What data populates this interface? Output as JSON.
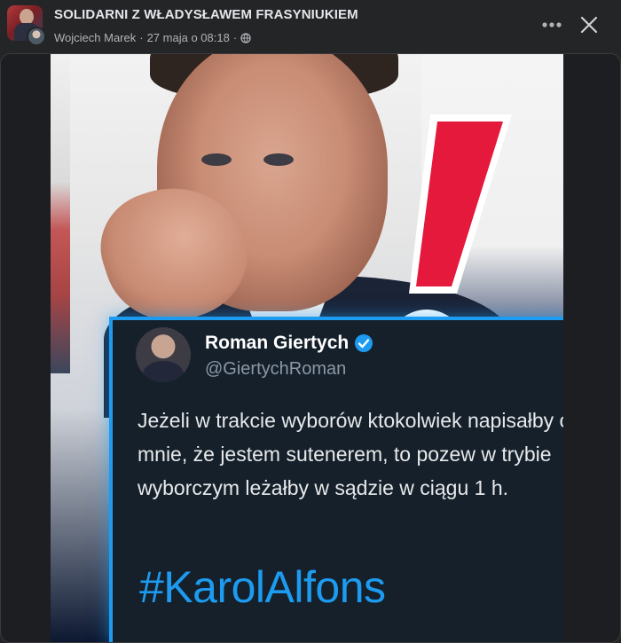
{
  "post": {
    "group_name": "SOLIDARNI Z WŁADYSŁAWEM FRASYNIUKIEM",
    "author": "Wojciech Marek",
    "timestamp": "27 maja o 08:18",
    "separator": "·",
    "privacy_icon": "globe-icon",
    "more_icon": "ellipsis-icon",
    "close_icon": "close-icon"
  },
  "image": {
    "tweet": {
      "author_name": "Roman Giertych",
      "handle": "@GiertychRoman",
      "verified_icon": "verified-badge-icon",
      "text": "Jeżeli w trakcie wyborów ktokolwiek napisałby o mnie, że jestem sutenerem, to pozew w trybie wyborczym leżałby w sądzie w ciągu 1 h.",
      "hashtag": "#KarolAlfons"
    },
    "colors": {
      "accent_blue": "#1d9bf0",
      "exclamation_red": "#e5193b",
      "tweet_bg": "#15202b"
    }
  }
}
